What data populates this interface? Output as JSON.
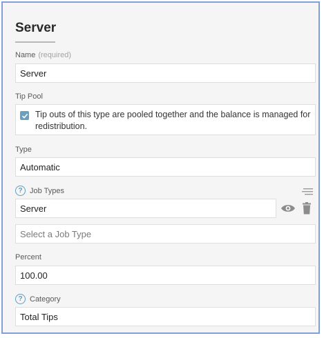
{
  "form": {
    "title": "Server",
    "name": {
      "label": "Name",
      "required_note": "(required)",
      "value": "Server"
    },
    "tip_pool": {
      "label": "Tip Pool",
      "checked": true,
      "text": "Tip outs of this type are pooled together and the balance is managed for redistribution."
    },
    "type": {
      "label": "Type",
      "value": "Automatic"
    },
    "job_types": {
      "label": "Job Types",
      "items": [
        "Server"
      ],
      "placeholder": "Select a Job Type"
    },
    "percent": {
      "label": "Percent",
      "value": "100.00"
    },
    "category": {
      "label": "Category",
      "value": "Total Tips"
    }
  },
  "icons": {
    "help": "question-circle-icon",
    "reorder": "reorder-lines-icon",
    "view": "eye-icon",
    "delete": "trash-icon",
    "check": "checkmark-icon"
  },
  "colors": {
    "accent": "#5f9dbd",
    "checkbox": "#6a9fbd",
    "frame_border": "#7f9fd6",
    "panel_bg": "#f5f5f5"
  }
}
